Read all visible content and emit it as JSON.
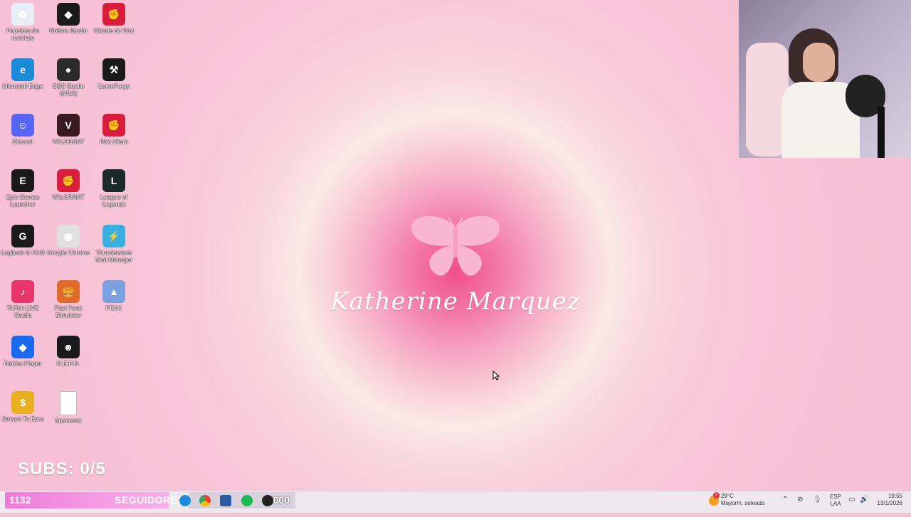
{
  "desktop_icons": [
    {
      "label": "Papelera de reciclaje",
      "col": 0,
      "row": 0,
      "color": "#e8eef6",
      "glyph": "♻"
    },
    {
      "label": "Roblox Studio",
      "col": 1,
      "row": 0,
      "color": "#1a1a1a",
      "glyph": "◆"
    },
    {
      "label": "Cliente de Riot",
      "col": 2,
      "row": 0,
      "color": "#d81e3c",
      "glyph": "✊"
    },
    {
      "label": "Microsoft Edge",
      "col": 0,
      "row": 1,
      "color": "#1b8ad8",
      "glyph": "e"
    },
    {
      "label": "OBS Studio (64bit)",
      "col": 1,
      "row": 1,
      "color": "#2a2a2a",
      "glyph": "●"
    },
    {
      "label": "CurseForge",
      "col": 2,
      "row": 1,
      "color": "#1a1a1a",
      "glyph": "⚒"
    },
    {
      "label": "Discord",
      "col": 0,
      "row": 2,
      "color": "#5865f2",
      "glyph": "☺"
    },
    {
      "label": "VALORANT",
      "col": 1,
      "row": 2,
      "color": "#3a1a22",
      "glyph": "V"
    },
    {
      "label": "Riot Client",
      "col": 2,
      "row": 2,
      "color": "#d81e3c",
      "glyph": "✊"
    },
    {
      "label": "Epic Games Launcher",
      "col": 0,
      "row": 3,
      "color": "#1a1a1a",
      "glyph": "E"
    },
    {
      "label": "VALORANT",
      "col": 1,
      "row": 3,
      "color": "#d81e3c",
      "glyph": "✊"
    },
    {
      "label": "League of Legends",
      "col": 2,
      "row": 3,
      "color": "#1a2a2a",
      "glyph": "L"
    },
    {
      "label": "Logitech G HUB",
      "col": 0,
      "row": 4,
      "color": "#1a1a1a",
      "glyph": "G"
    },
    {
      "label": "Google Chrome",
      "col": 1,
      "row": 4,
      "color": "#e0e0e0",
      "glyph": "◉"
    },
    {
      "label": "Thunderstore Mod Manager",
      "col": 2,
      "row": 4,
      "color": "#3ab0e0",
      "glyph": "⚡"
    },
    {
      "label": "TikTok LIVE Studio",
      "col": 0,
      "row": 5,
      "color": "#e8356b",
      "glyph": "♪"
    },
    {
      "label": "Fast Food Simulator",
      "col": 1,
      "row": 5,
      "color": "#e06a2a",
      "glyph": "🍔"
    },
    {
      "label": "PEAK",
      "col": 2,
      "row": 5,
      "color": "#7aa0e0",
      "glyph": "▲"
    },
    {
      "label": "Roblox Player",
      "col": 0,
      "row": 6,
      "color": "#1a6af0",
      "glyph": "◆"
    },
    {
      "label": "R.E.P.O.",
      "col": 1,
      "row": 6,
      "color": "#1a1a1a",
      "glyph": "☻"
    },
    {
      "label": "Stream To Earn",
      "col": 0,
      "row": 7,
      "color": "#e8b020",
      "glyph": "$"
    },
    {
      "label": "Spacewar",
      "col": 1,
      "row": 7,
      "color": "#ffffff",
      "glyph": ""
    }
  ],
  "wallpaper": {
    "name": "Katherine Marquez"
  },
  "overlay": {
    "subs_goal": "SUBS: 0/5",
    "followers_count": "1132",
    "followers_label": "SEGUIDORES",
    "followers_goal": "2000",
    "followers_progress": 0.566
  },
  "taskbar": {
    "pinned": [
      "edge-icon",
      "chrome-icon",
      "file-explorer-icon",
      "spotify-icon",
      "obs-icon"
    ]
  },
  "tray": {
    "weather_temp": "29°C",
    "weather_desc": "Mayorm. soleado",
    "weather_badge": "2",
    "lang_top": "ESP",
    "lang_bottom": "LAA",
    "time": "19:55",
    "date": "13/1/2026"
  },
  "colors": {
    "accent_pink": "#ee7bd8",
    "wallpaper_center": "#f0508a"
  }
}
